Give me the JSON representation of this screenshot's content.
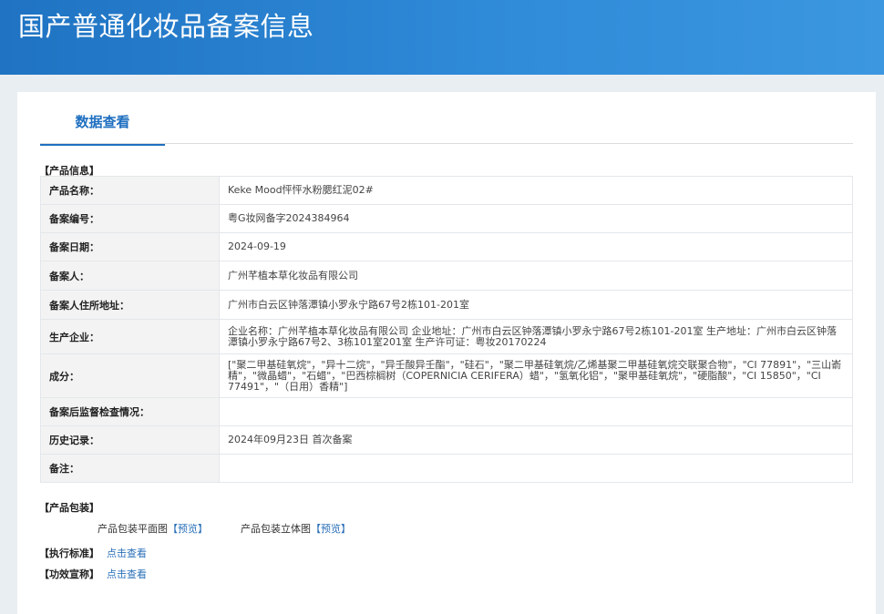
{
  "header": {
    "title": "国产普通化妆品备案信息"
  },
  "tab": {
    "label": "数据查看"
  },
  "product_info": {
    "section_title": "【产品信息】",
    "rows": [
      {
        "key": "产品名称：",
        "value": "Keke Mood怦怦水粉腮红泥02#"
      },
      {
        "key": "备案编号：",
        "value": "粤G妆网备字2024384964"
      },
      {
        "key": "备案日期：",
        "value": "2024-09-19"
      },
      {
        "key": "备案人：",
        "value": "广州芊植本草化妆品有限公司"
      },
      {
        "key": "备案人住所地址：",
        "value": "广州市白云区钟落潭镇小罗永宁路67号2栋101-201室"
      },
      {
        "key": "生产企业：",
        "value": "企业名称：广州芊植本草化妆品有限公司 企业地址：广州市白云区钟落潭镇小罗永宁路67号2栋101-201室 生产地址：广州市白云区钟落潭镇小罗永宁路67号2、3栋101室201室 生产许可证：粤妆20170224"
      },
      {
        "key": "成分：",
        "value": "[\"聚二甲基硅氧烷\"，\"异十二烷\"，\"异壬酸异壬酯\"，\"硅石\"，\"聚二甲基硅氧烷/乙烯基聚二甲基硅氧烷交联聚合物\"，\"CI 77891\"，\"三山嵛精\"，\"微晶蜡\"，\"石蜡\"，\"巴西棕榈树（COPERNICIA CERIFERA）蜡\"，\"氢氧化铝\"，\"聚甲基硅氧烷\"，\"硬脂酸\"，\"CI 15850\"，\"CI 77491\"，\"（日用）香精\"]"
      },
      {
        "key": "备案后监督检查情况：",
        "value": ""
      },
      {
        "key": "历史记录：",
        "value": "2024年09月23日 首次备案"
      },
      {
        "key": "备注：",
        "value": ""
      }
    ]
  },
  "packaging": {
    "section_title": "【产品包装】",
    "items": [
      {
        "label": "产品包装平面图",
        "link": "【预览】"
      },
      {
        "label": "产品包装立体图",
        "link": "【预览】"
      }
    ]
  },
  "standard": {
    "key": "【执行标准】",
    "link": "点击查看"
  },
  "efficacy": {
    "key": "【功效宣称】",
    "link": "点击查看"
  }
}
